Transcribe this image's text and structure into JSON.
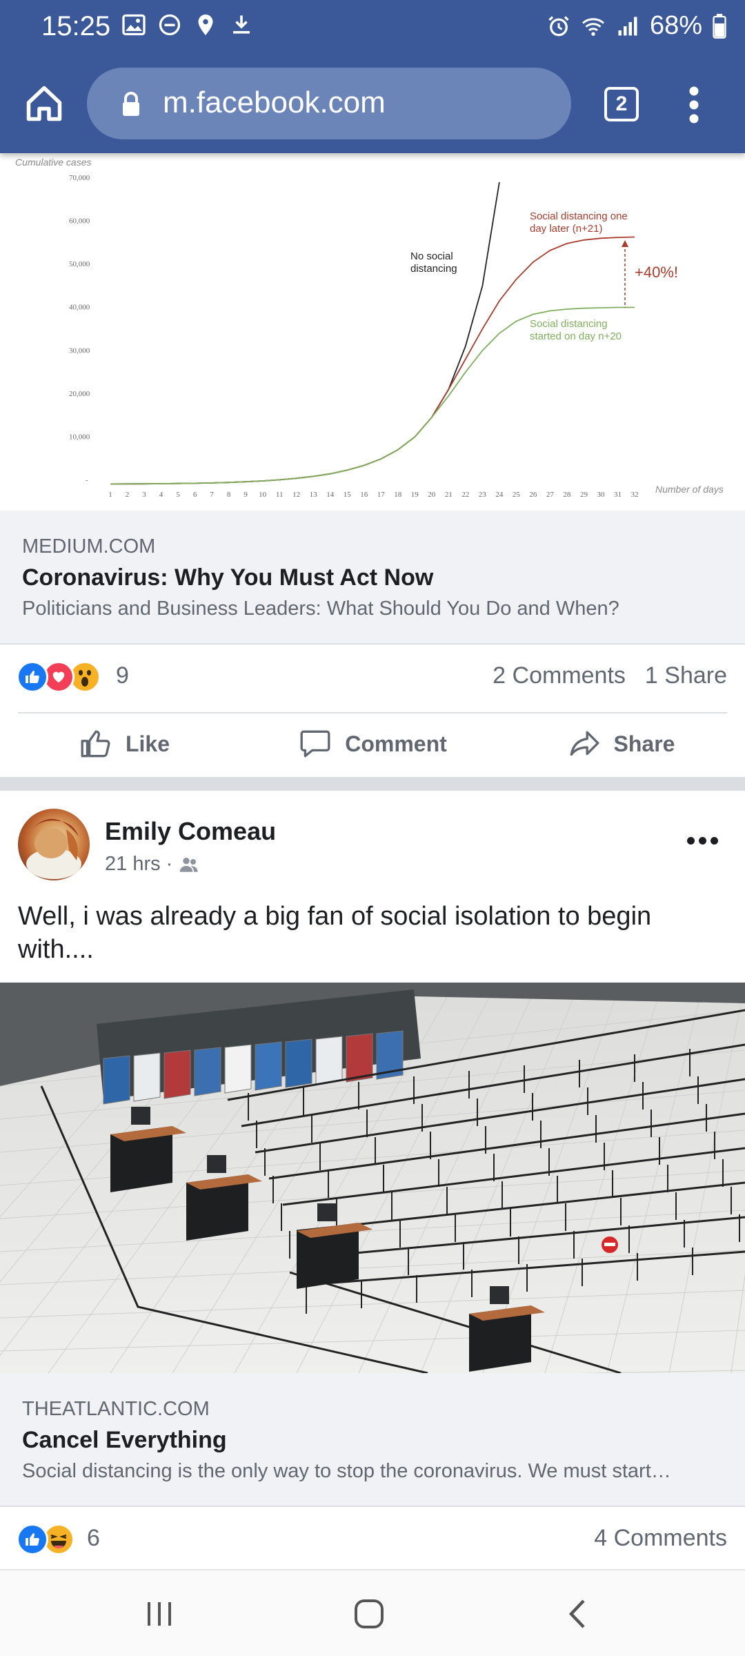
{
  "status_bar": {
    "time": "15:25",
    "battery": "68%"
  },
  "browser": {
    "url": "m.facebook.com",
    "tab_count": "2"
  },
  "chart_data": {
    "type": "line",
    "ylabel": "Cumulative cases",
    "xlabel": "Number of days",
    "y_ticks": [
      "70,000",
      "60,000",
      "50,000",
      "40,000",
      "30,000",
      "20,000",
      "10,000",
      "-"
    ],
    "ylim": [
      0,
      70000
    ],
    "x": [
      1,
      2,
      3,
      4,
      5,
      6,
      7,
      8,
      9,
      10,
      11,
      12,
      13,
      14,
      15,
      16,
      17,
      18,
      19,
      20,
      21,
      22,
      23,
      24,
      25,
      26,
      27,
      28,
      29,
      30,
      31,
      32
    ],
    "series": [
      {
        "name": "No social distancing",
        "color": "#222222",
        "values": [
          100,
          110,
          130,
          160,
          200,
          260,
          340,
          450,
          600,
          800,
          1050,
          1400,
          1850,
          2450,
          3300,
          4400,
          5900,
          8000,
          11000,
          15500,
          22000,
          32000,
          46000,
          70000,
          null,
          null,
          null,
          null,
          null,
          null,
          null,
          null
        ]
      },
      {
        "name": "Social distancing one day later (n+21)",
        "color": "#a93b2c",
        "values": [
          100,
          110,
          130,
          160,
          200,
          260,
          340,
          450,
          600,
          800,
          1050,
          1400,
          1850,
          2450,
          3300,
          4400,
          5900,
          8000,
          11000,
          15500,
          22000,
          29000,
          36000,
          42500,
          47500,
          51500,
          54200,
          55800,
          56600,
          57000,
          57200,
          57300
        ]
      },
      {
        "name": "Social distancing started on day n+20",
        "color": "#7fae5c",
        "values": [
          100,
          110,
          130,
          160,
          200,
          260,
          340,
          450,
          600,
          800,
          1050,
          1400,
          1850,
          2450,
          3300,
          4400,
          5900,
          8000,
          11000,
          15500,
          20500,
          26000,
          31000,
          35000,
          37800,
          39400,
          40200,
          40600,
          40800,
          40900,
          41000,
          41000
        ]
      }
    ],
    "annotation": "+40%!",
    "series_labels": {
      "no_sd": [
        "No social",
        "distancing"
      ],
      "later": [
        "Social distancing one",
        "day later (n+21)"
      ],
      "started": [
        "Social distancing",
        "started on day n+20"
      ]
    }
  },
  "post1": {
    "link": {
      "domain": "MEDIUM.COM",
      "title": "Coronavirus: Why You Must Act Now",
      "description": "Politicians and Business Leaders: What Should You Do and When?"
    },
    "reaction_count": "9",
    "comments": "2 Comments",
    "shares": "1 Share",
    "actions": {
      "like": "Like",
      "comment": "Comment",
      "share": "Share"
    }
  },
  "post2": {
    "author": "Emily Comeau",
    "time": "21 hrs ·",
    "text": "Well, i was already a big fan of social isolation to begin with....",
    "link": {
      "domain": "THEATLANTIC.COM",
      "title": "Cancel Everything",
      "description": "Social distancing is the only way to stop the coronavirus. We must start…"
    },
    "reaction_count": "6",
    "comments": "4 Comments"
  },
  "colors": {
    "facebook_blue": "#3b5998",
    "like_blue": "#1877f2",
    "love_red": "#f33e58",
    "wow_yellow": "#f7b125"
  }
}
